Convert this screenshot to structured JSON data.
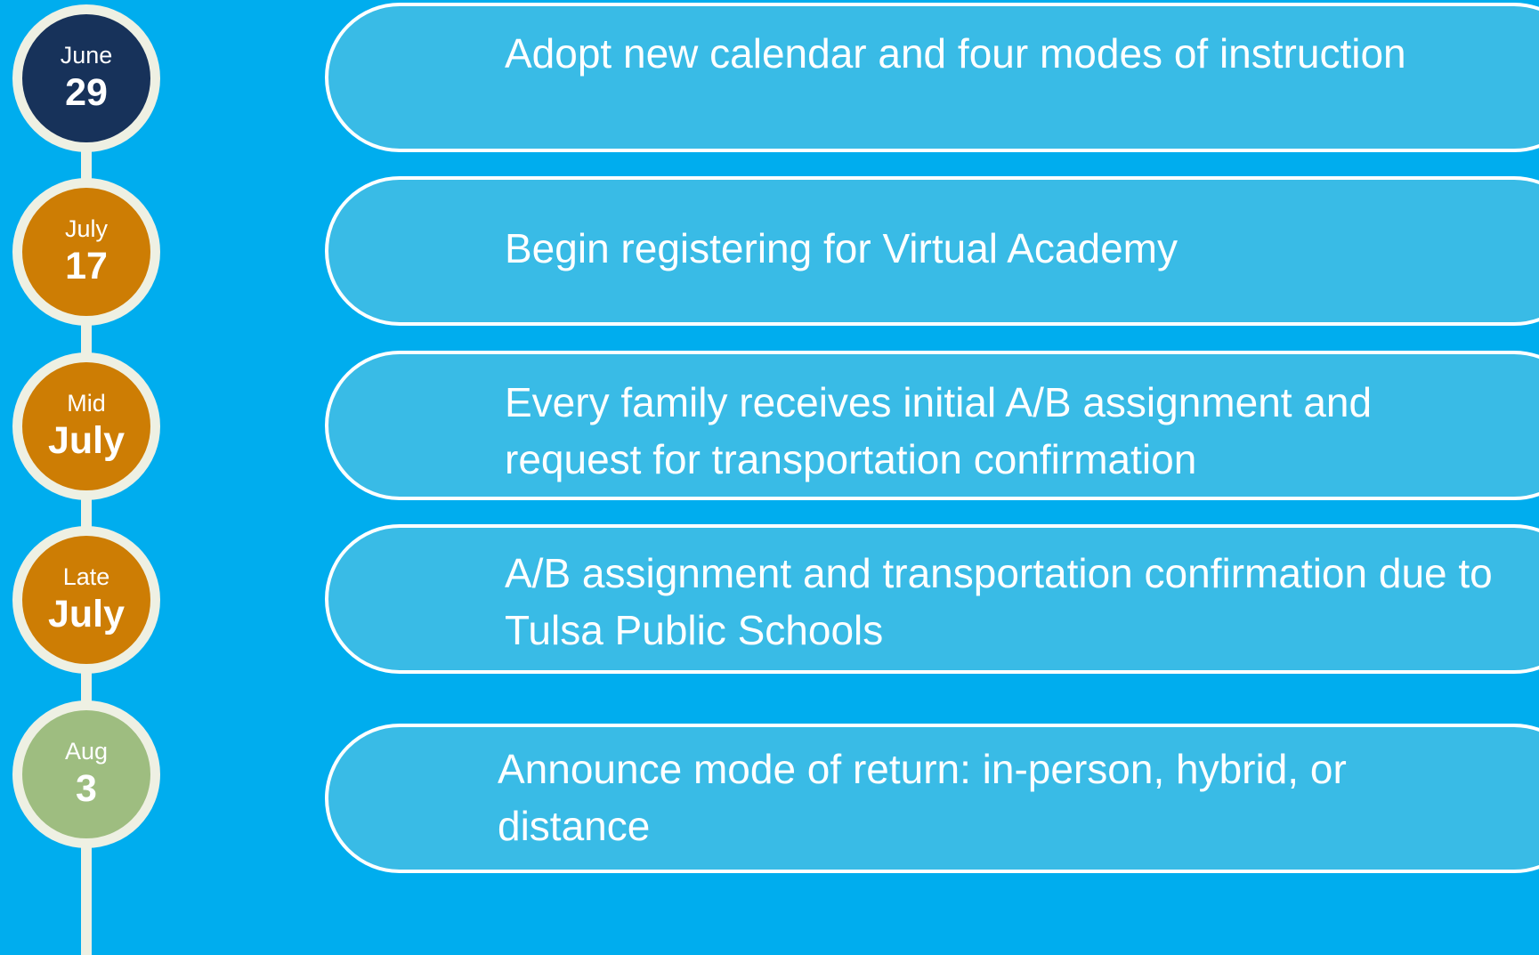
{
  "colors": {
    "background": "#00adee",
    "pill_fill": "#39bbe6",
    "pill_border": "#ffffff",
    "timeline_line": "#eef0e3",
    "text": "#ffffff"
  },
  "milestones": [
    {
      "top_label": "June",
      "main_label": "29",
      "color": "#17325a"
    },
    {
      "top_label": "July",
      "main_label": "17",
      "color": "#cd7d04"
    },
    {
      "top_label": "Mid",
      "main_label": "July",
      "color": "#cd7d04"
    },
    {
      "top_label": "Late",
      "main_label": "July",
      "color": "#cd7d04"
    },
    {
      "top_label": "Aug",
      "main_label": "3",
      "color": "#9ebd80"
    }
  ],
  "events": [
    {
      "text": "Adopt new calendar and four modes of instruction"
    },
    {
      "text": "Begin registering for Virtual Academy"
    },
    {
      "text": "Every family receives initial A/B assignment and request for transportation confirmation"
    },
    {
      "text": "A/B assignment and transportation confirmation due to Tulsa Public Schools"
    },
    {
      "text": "Announce mode of return: in-person, hybrid, or distance"
    }
  ]
}
